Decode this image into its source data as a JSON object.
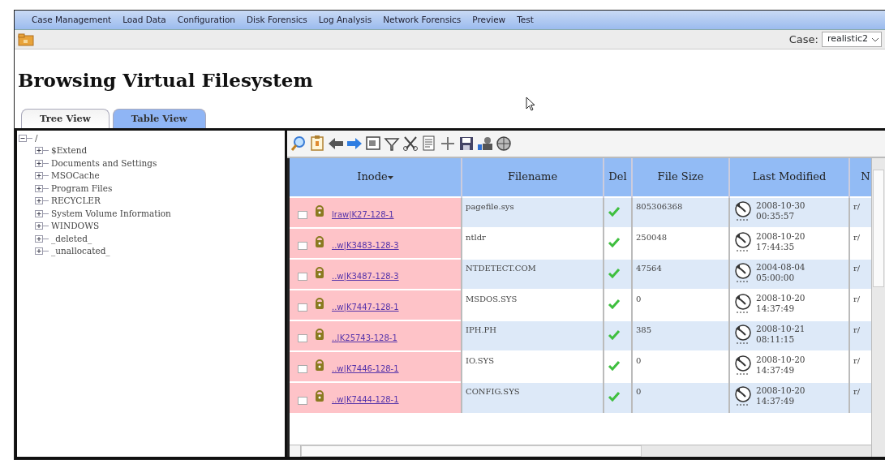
{
  "menu": [
    {
      "label": "Case Management"
    },
    {
      "label": "Load Data"
    },
    {
      "label": "Configuration"
    },
    {
      "label": "Disk Forensics"
    },
    {
      "label": "Log Analysis"
    },
    {
      "label": "Network Forensics"
    },
    {
      "label": "Preview"
    },
    {
      "label": "Test"
    }
  ],
  "case_selector": {
    "label": "Case:",
    "value": "realistic2"
  },
  "heading": "Browsing Virtual Filesystem",
  "tabs": [
    {
      "label": "Tree View",
      "selected": false
    },
    {
      "label": "Table View",
      "selected": true
    }
  ],
  "tree": [
    {
      "label": "/",
      "expanded": true,
      "children": [
        {
          "label": "$Extend",
          "expanded": false
        },
        {
          "label": "Documents and Settings",
          "expanded": false
        },
        {
          "label": "MSOCache",
          "expanded": false
        },
        {
          "label": "Program Files",
          "expanded": false
        },
        {
          "label": "RECYCLER",
          "expanded": false
        },
        {
          "label": "System Volume Information",
          "expanded": false
        },
        {
          "label": "WINDOWS",
          "expanded": false
        },
        {
          "label": "_deleted_",
          "expanded": false
        },
        {
          "label": "_unallocated_",
          "expanded": false
        }
      ]
    }
  ],
  "table": {
    "columns": [
      {
        "label": "Inode",
        "sorted": true
      },
      {
        "label": "Filename",
        "sorted": false
      },
      {
        "label": "Del",
        "sorted": false
      },
      {
        "label": "File Size",
        "sorted": false
      },
      {
        "label": "Last Modified",
        "sorted": false
      },
      {
        "label": "N",
        "sorted": false
      }
    ],
    "rows": [
      {
        "checked": false,
        "inode": "lraw|K27-128-1",
        "filename": "pagefile.sys",
        "deleted": true,
        "size": "805306368",
        "date": "2008-10-30",
        "time": "00:35:57",
        "column_6": "r/"
      },
      {
        "checked": false,
        "inode": "..w|K3483-128-3",
        "filename": "ntldr",
        "deleted": true,
        "size": "250048",
        "date": "2008-10-20",
        "time": "17:44:35",
        "column_6": "r/"
      },
      {
        "checked": false,
        "inode": "..w|K3487-128-3",
        "filename": "NTDETECT.COM",
        "deleted": true,
        "size": "47564",
        "date": "2004-08-04",
        "time": "05:00:00",
        "column_6": "r/"
      },
      {
        "checked": false,
        "inode": "..w|K7447-128-1",
        "filename": "MSDOS.SYS",
        "deleted": true,
        "size": "0",
        "date": "2008-10-20",
        "time": "14:37:49",
        "column_6": "r/"
      },
      {
        "checked": false,
        "inode": "..|K25743-128-1",
        "filename": "IPH.PH",
        "deleted": true,
        "size": "385",
        "date": "2008-10-21",
        "time": "08:11:15",
        "column_6": "r/"
      },
      {
        "checked": false,
        "inode": "..w|K7446-128-1",
        "filename": "IO.SYS",
        "deleted": true,
        "size": "0",
        "date": "2008-10-20",
        "time": "14:37:49",
        "column_6": "r/"
      },
      {
        "checked": false,
        "inode": "..w|K7444-128-1",
        "filename": "CONFIG.SYS",
        "deleted": true,
        "size": "0",
        "date": "2008-10-20",
        "time": "14:37:49",
        "column_6": "r/"
      }
    ]
  }
}
